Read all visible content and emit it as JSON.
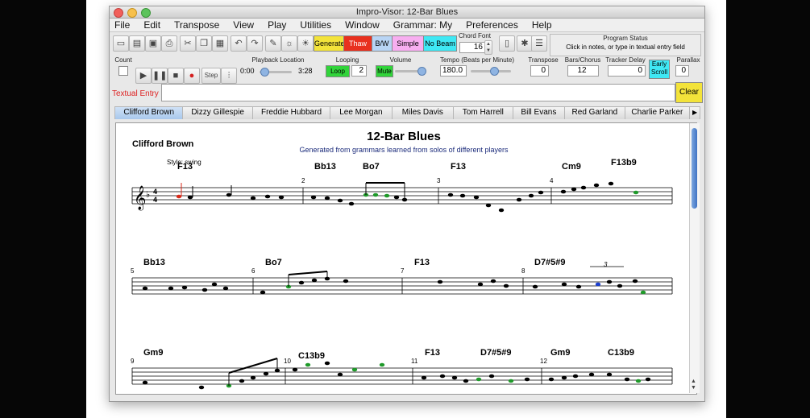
{
  "window": {
    "title": "Impro-Visor: 12-Bar Blues"
  },
  "menu": [
    "File",
    "Edit",
    "Transpose",
    "View",
    "Play",
    "Utilities",
    "Window",
    "Grammar: My",
    "Preferences",
    "Help"
  ],
  "toolbar": {
    "generate": "Generate",
    "thaw": "Thaw",
    "bw": "B/W",
    "simple": "Simple",
    "no_beam": "No Beam",
    "chord_font_label": "Chord Font",
    "chord_font_value": "16",
    "program_status_label": "Program Status",
    "program_status_text": "Click in notes, or type in textual entry field"
  },
  "transport": {
    "count_label": "Count",
    "step_label": "Step",
    "playback_label": "Playback Location",
    "playback_start": "0:00",
    "playback_end": "3:28",
    "looping_label": "Looping",
    "loop_button": "Loop",
    "loop_count": "2",
    "volume_label": "Volume",
    "mute_button": "Mute",
    "tempo_label": "Tempo (Beats per Minute)",
    "tempo_value": "180.0",
    "transpose_label": "Transpose",
    "transpose_value": "0",
    "bars_label": "Bars/Chorus",
    "bars_value": "12",
    "tracker_label": "Tracker Delay",
    "tracker_value": "0",
    "early_scroll": "Early Scroll",
    "parallax_label": "Parallax",
    "parallax_value": "0"
  },
  "textual": {
    "label": "Textual Entry",
    "clear": "Clear",
    "value": ""
  },
  "tabs": [
    "Clifford Brown",
    "Dizzy Gillespie",
    "Freddie Hubbard",
    "Lee Morgan",
    "Miles Davis",
    "Tom Harrell",
    "Bill Evans",
    "Red Garland",
    "Charlie Parker"
  ],
  "score": {
    "title": "12-Bar Blues",
    "subtitle": "Generated from grammars learned from solos of different players",
    "part": "Clifford Brown",
    "style": "Style: swing",
    "systems": [
      {
        "measure_numbers": [
          "2",
          "3",
          "4"
        ],
        "chords": [
          "F13",
          "Bb13",
          "Bo7",
          "F13",
          "Cm9",
          "F13b9"
        ]
      },
      {
        "measure_numbers": [
          "5",
          "6",
          "7",
          "8"
        ],
        "chords": [
          "Bb13",
          "Bo7",
          "F13",
          "D7#5#9"
        ],
        "tuplet": "3"
      },
      {
        "measure_numbers": [
          "9",
          "10",
          "11",
          "12"
        ],
        "chords": [
          "Gm9",
          "C13b9",
          "F13",
          "D7#5#9",
          "Gm9",
          "C13b9"
        ]
      }
    ]
  }
}
